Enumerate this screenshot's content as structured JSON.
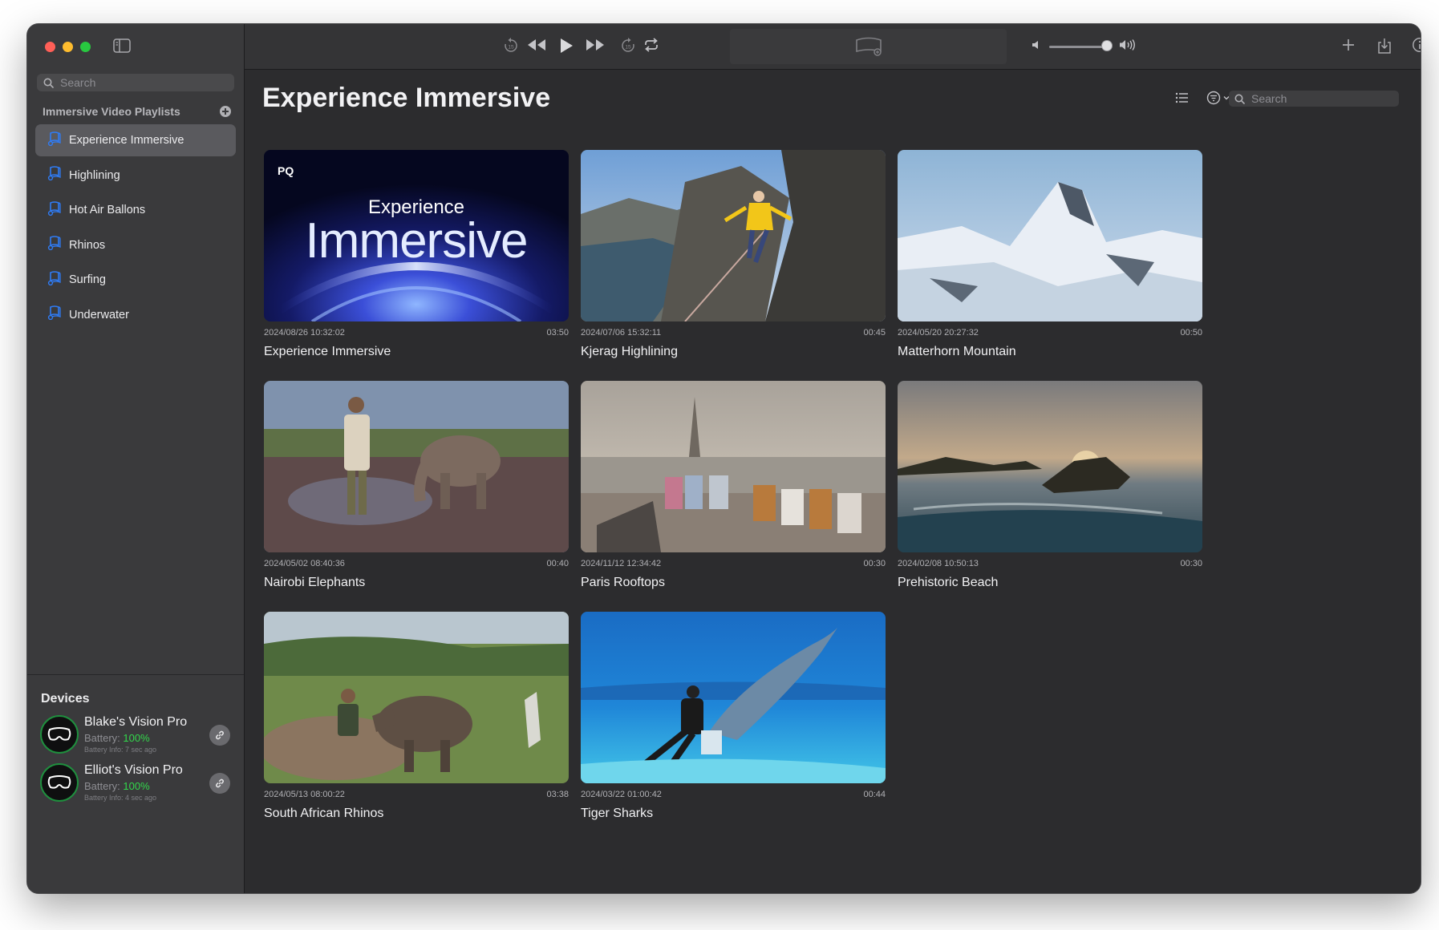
{
  "sidebar": {
    "search_placeholder": "Search",
    "playlists_header": "Immersive Video Playlists",
    "playlists": [
      {
        "label": "Experience Immersive",
        "active": true
      },
      {
        "label": "Highlining",
        "active": false
      },
      {
        "label": "Hot Air Ballons",
        "active": false
      },
      {
        "label": "Rhinos",
        "active": false
      },
      {
        "label": "Surfing",
        "active": false
      },
      {
        "label": "Underwater",
        "active": false
      }
    ],
    "devices_title": "Devices",
    "devices": [
      {
        "name": "Blake's Vision Pro",
        "battery_label": "Battery:",
        "battery_value": "100%",
        "info": "Battery Info: 7 sec ago"
      },
      {
        "name": "Elliot's Vision Pro",
        "battery_label": "Battery:",
        "battery_value": "100%",
        "info": "Battery Info: 4 sec ago"
      }
    ]
  },
  "toolbar": {
    "icons": [
      "skip-back-15-icon",
      "rewind-icon",
      "play-icon",
      "fast-forward-icon",
      "skip-forward-15-icon",
      "repeat-icon",
      "airplay-icon",
      "volume-low-icon",
      "volume-high-icon",
      "plus-icon",
      "download-icon",
      "info-icon"
    ],
    "volume_level": 0.9
  },
  "main": {
    "title": "Experience Immersive",
    "search_placeholder": "Search",
    "videos": [
      {
        "title": "Experience Immersive",
        "date": "2024/08/26 10:32:02",
        "duration": "03:50",
        "badge": "PQ",
        "overlay_line1": "Experience",
        "overlay_line2": "Immersive"
      },
      {
        "title": "Kjerag Highlining",
        "date": "2024/07/06 15:32:11",
        "duration": "00:45"
      },
      {
        "title": "Matterhorn Mountain",
        "date": "2024/05/20 20:27:32",
        "duration": "00:50"
      },
      {
        "title": "Nairobi Elephants",
        "date": "2024/05/02 08:40:36",
        "duration": "00:40"
      },
      {
        "title": "Paris Rooftops",
        "date": "2024/11/12 12:34:42",
        "duration": "00:30"
      },
      {
        "title": "Prehistoric Beach",
        "date": "2024/02/08 10:50:13",
        "duration": "00:30"
      },
      {
        "title": "South African Rhinos",
        "date": "2024/05/13 08:00:22",
        "duration": "03:38"
      },
      {
        "title": "Tiger Sharks",
        "date": "2024/03/22 01:00:42",
        "duration": "00:44"
      }
    ]
  },
  "colors": {
    "accent": "#2f7cf6",
    "battery_green": "#32d74b",
    "sidebar_bg": "#3a3a3c",
    "main_bg": "#2c2c2e"
  }
}
